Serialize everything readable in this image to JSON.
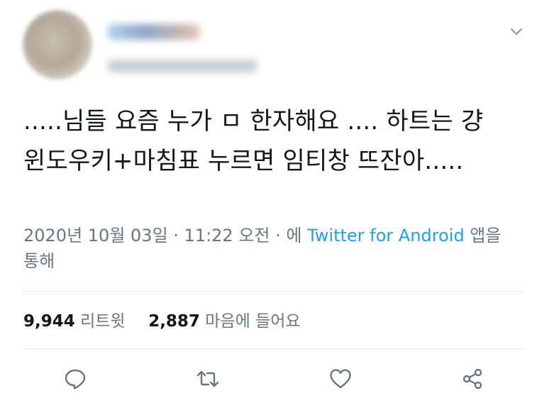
{
  "tweet": {
    "text": ".....님들 요즘 누가 ㅁ 한자해요 .... 하트는 걍 윈도우키+마침표 누르면 임티창 뜨잔아.....",
    "date": "2020년 10월 03일 · 11:22 오전 · 에 ",
    "source": "Twitter for Android",
    "source_suffix": " 앱을 통해"
  },
  "stats": {
    "retweets_count": "9,944",
    "retweets_label": "리트윗",
    "likes_count": "2,887",
    "likes_label": "마음에 들어요"
  },
  "icons": {
    "menu": "chevron-down-icon",
    "reply": "reply-icon",
    "retweet": "retweet-icon",
    "like": "heart-icon",
    "share": "share-icon"
  },
  "colors": {
    "text": "#14171a",
    "secondary": "#657786",
    "link": "#1da1f2",
    "divider": "#e1e8ed"
  }
}
